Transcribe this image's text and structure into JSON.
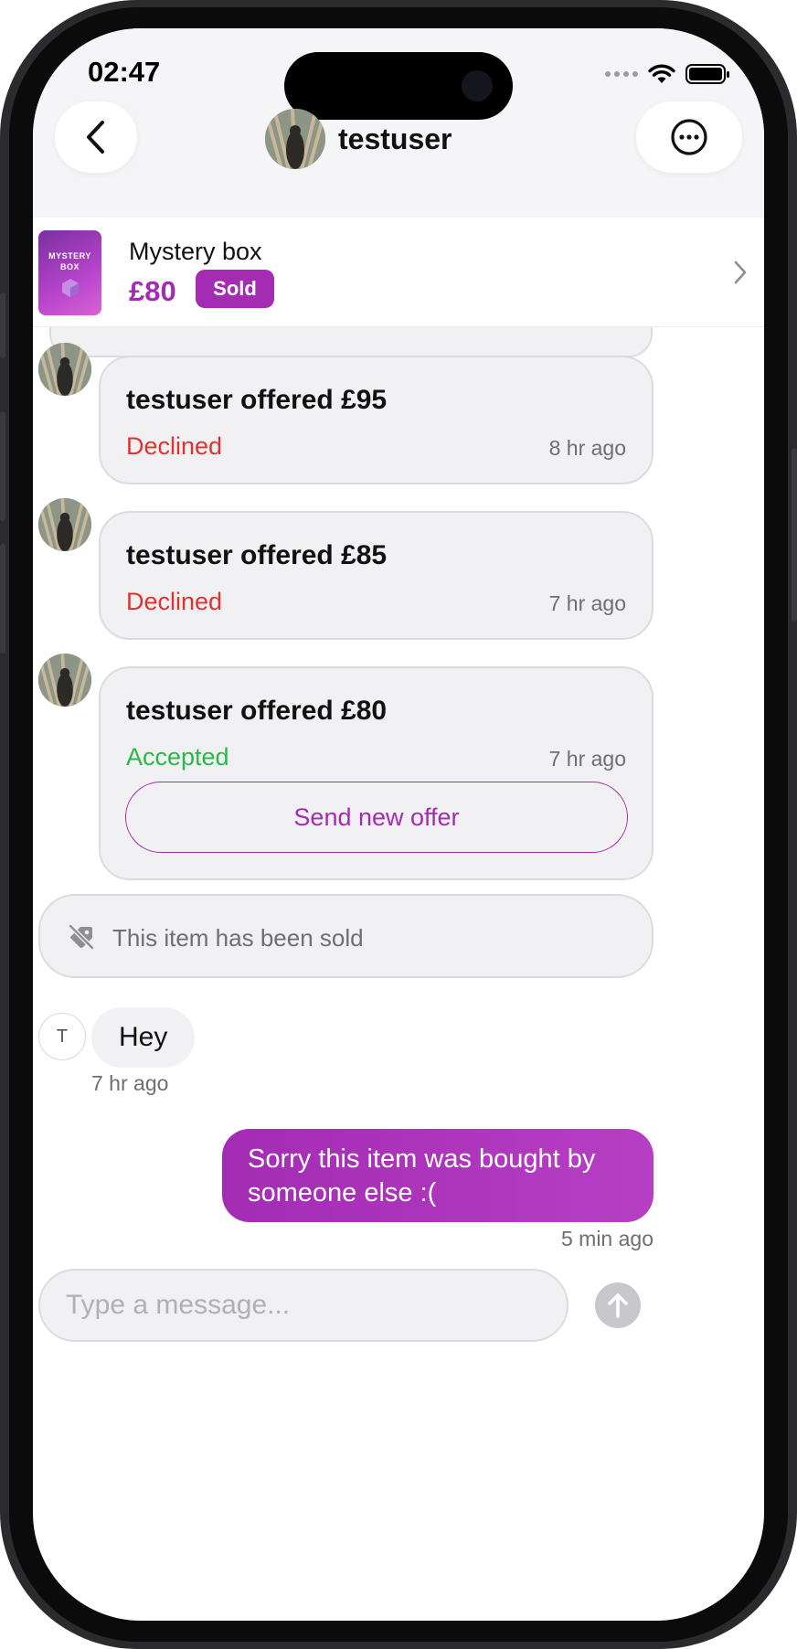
{
  "status_bar": {
    "time": "02:47"
  },
  "header": {
    "username": "testuser"
  },
  "product": {
    "thumbnail_text": "MYSTERY BOX",
    "title": "Mystery box",
    "price": "£80",
    "badge": "Sold"
  },
  "offers": [
    {
      "text": "testuser offered £95",
      "status": "Declined",
      "time": "8 hr ago"
    },
    {
      "text": "testuser offered £85",
      "status": "Declined",
      "time": "7 hr ago"
    },
    {
      "text": "testuser offered £80",
      "status": "Accepted",
      "time": "7 hr ago",
      "action": "Send new offer"
    }
  ],
  "sold_notice": "This item has been sold",
  "messages": [
    {
      "direction": "incoming",
      "avatar_initial": "T",
      "text": "Hey",
      "time": "7 hr ago"
    },
    {
      "direction": "outgoing",
      "text": "Sorry this item was bought by someone else :(",
      "time": "5 min ago"
    }
  ],
  "composer": {
    "placeholder": "Type a message..."
  },
  "colors": {
    "accent": "#a32cb3",
    "declined": "#e0322f",
    "accepted": "#2bb84a"
  },
  "icons": [
    "back-chevron-icon",
    "more-options-icon",
    "chevron-right-icon",
    "sold-tag-icon",
    "send-arrow-icon",
    "wifi-icon",
    "battery-icon"
  ]
}
